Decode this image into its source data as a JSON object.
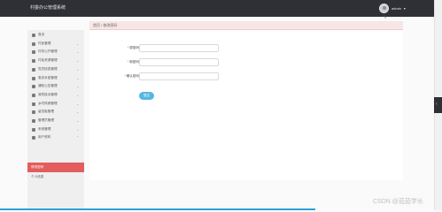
{
  "app": {
    "title": "村委办公管理系统"
  },
  "user": {
    "name": "admin",
    "caret": "▾"
  },
  "sidebar": {
    "items": [
      {
        "label": "首页",
        "has_chevron": false
      },
      {
        "label": "村民管理",
        "has_chevron": true
      },
      {
        "label": "村务公开管理",
        "has_chevron": true
      },
      {
        "label": "村民资源管理",
        "has_chevron": true
      },
      {
        "label": "党员信息管理",
        "has_chevron": true
      },
      {
        "label": "惠农补贴管理",
        "has_chevron": true
      },
      {
        "label": "通知公告管理",
        "has_chevron": true
      },
      {
        "label": "我的投诉管理",
        "has_chevron": true
      },
      {
        "label": "乡村风貌管理",
        "has_chevron": true
      },
      {
        "label": "留言板管理",
        "has_chevron": true
      },
      {
        "label": "管理员管理",
        "has_chevron": true
      },
      {
        "label": "系统管理",
        "has_chevron": true
      },
      {
        "label": "用户资料",
        "has_chevron": true
      },
      {
        "label": "修改密码",
        "has_chevron": false,
        "active": true
      },
      {
        "label": "个人信息",
        "has_chevron": false
      }
    ]
  },
  "breadcrumb": "首页 / 修改密码",
  "form": {
    "fields": [
      {
        "label": "原密码",
        "required": "*",
        "value": ""
      },
      {
        "label": "新密码",
        "required": "*",
        "value": ""
      },
      {
        "label": "确认密码",
        "required": "*",
        "value": ""
      }
    ],
    "submit_label": "提交"
  },
  "watermark": "CSDN @茄茄学长"
}
